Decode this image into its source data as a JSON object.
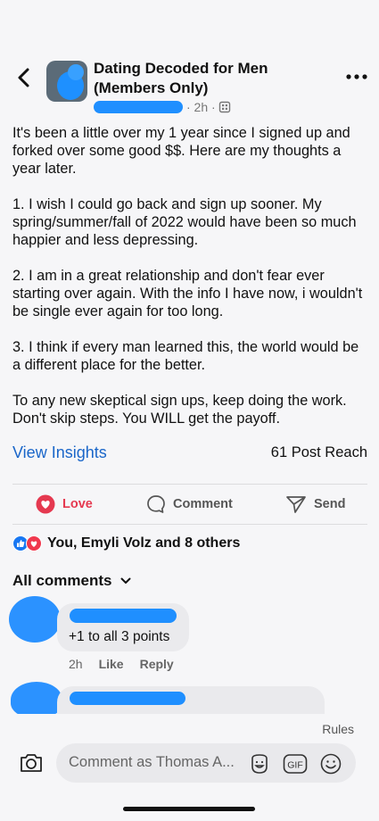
{
  "group": {
    "title": "Dating Decoded for Men (Members Only)",
    "time": "· 2h ·"
  },
  "post": {
    "paragraphs": [
      "It's been a little over my 1 year since I signed up and forked over some good $$. Here are my thoughts a year later.",
      "1. I wish I could go back and sign up sooner. My spring/summer/fall of 2022 would have been so much happier and less depressing.",
      "2. I am in a great relationship and don't fear ever starting over again. With the info I have now, i wouldn't be single ever again for too long.",
      "3. I think if every man learned this, the world would be a different place for the better.",
      "To any new skeptical sign ups, keep doing the work. Don't skip steps. You WILL get the payoff."
    ]
  },
  "insights": {
    "link": "View Insights",
    "reach": "61 Post Reach"
  },
  "actions": {
    "love": "Love",
    "comment": "Comment",
    "send": "Send"
  },
  "reactions": {
    "summary": "You, Emyli Volz and 8 others"
  },
  "comments": {
    "header": "All comments",
    "items": [
      {
        "text": "+1 to all 3 points",
        "time": "2h",
        "like": "Like",
        "reply": "Reply"
      }
    ]
  },
  "footer": {
    "rules": "Rules",
    "placeholder": "Comment as Thomas A...",
    "gif": "GIF"
  },
  "colors": {
    "accent": "#1a66c9",
    "love": "#e53950",
    "redaction": "#1f8fff"
  }
}
